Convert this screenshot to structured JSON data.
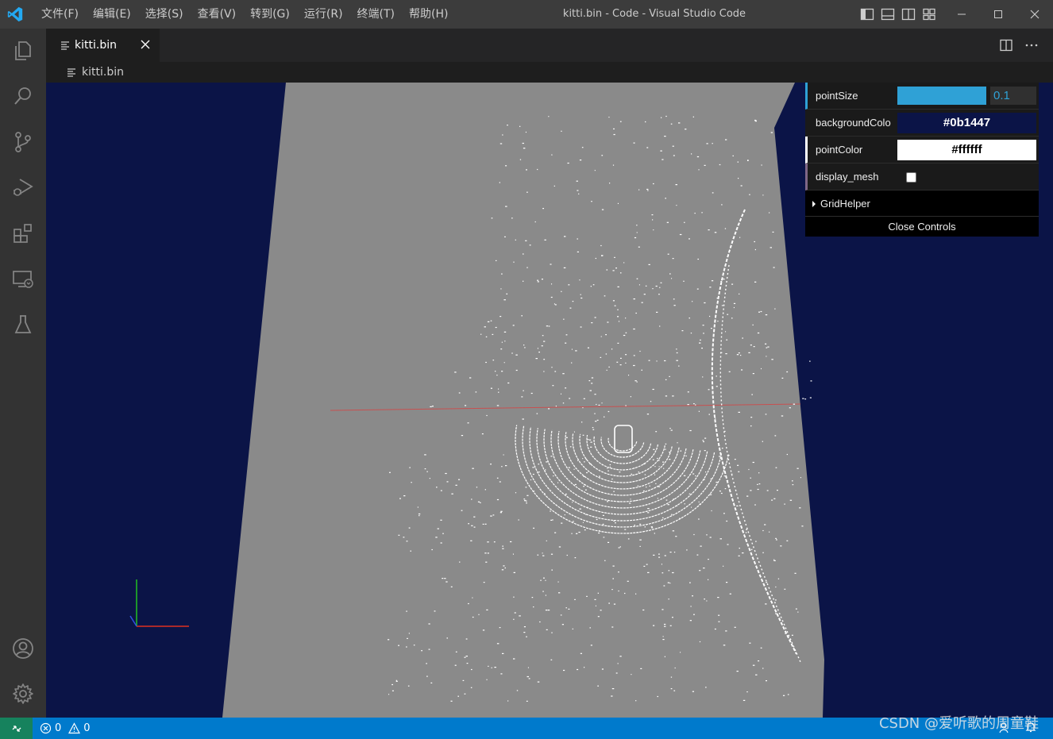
{
  "window": {
    "title": "kitti.bin - Code - Visual Studio Code",
    "menu": [
      "文件(F)",
      "编辑(E)",
      "选择(S)",
      "查看(V)",
      "转到(G)",
      "运行(R)",
      "终端(T)",
      "帮助(H)"
    ]
  },
  "activity_bar": {
    "items": [
      "explorer-icon",
      "search-icon",
      "source-control-icon",
      "run-debug-icon",
      "extensions-icon",
      "remote-explorer-icon",
      "testing-icon"
    ],
    "bottom": [
      "accounts-icon",
      "manage-gear-icon"
    ]
  },
  "editor": {
    "tab_label": "kitti.bin",
    "breadcrumb": "kitti.bin",
    "background_color": "#0b1447",
    "ground_color": "#8a8a8a",
    "point_color": "#ffffff"
  },
  "gui": {
    "point_size": {
      "label": "pointSize",
      "value": "0.1",
      "fill": 1.0
    },
    "background_color": {
      "label": "backgroundColo",
      "value": "#0b1447"
    },
    "point_color": {
      "label": "pointColor",
      "value": "#ffffff"
    },
    "display_mesh": {
      "label": "display_mesh",
      "checked": false
    },
    "grid_helper": {
      "label": "GridHelper"
    },
    "close_label": "Close Controls"
  },
  "status_bar": {
    "errors": "0",
    "warnings": "0",
    "accent": "#007acc",
    "remote_accent": "#16825d"
  },
  "watermark": "CSDN @爱听歌的周童鞋"
}
